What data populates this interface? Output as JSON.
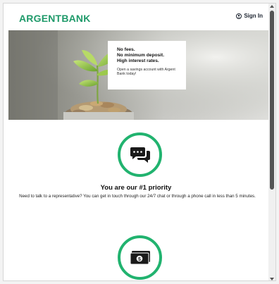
{
  "header": {
    "logo_part1": "ARGENT",
    "logo_part2": "BANK",
    "signin_label": "Sign In"
  },
  "hero": {
    "promo_lines": [
      "No fees.",
      "No minimum deposit.",
      "High interest rates."
    ],
    "promo_small": "Open a savings account with Argent Bank today!"
  },
  "features": [
    {
      "icon": "chat-icon",
      "title": "You are our #1 priority",
      "description": "Need to talk to a representative? You can get in touch through our 24/7 chat or through a phone call in less than 5 minutes."
    },
    {
      "icon": "money-icon"
    }
  ],
  "colors": {
    "brand": "#1f9a6a",
    "accent_ring": "#21b36f",
    "text": "#111111"
  }
}
